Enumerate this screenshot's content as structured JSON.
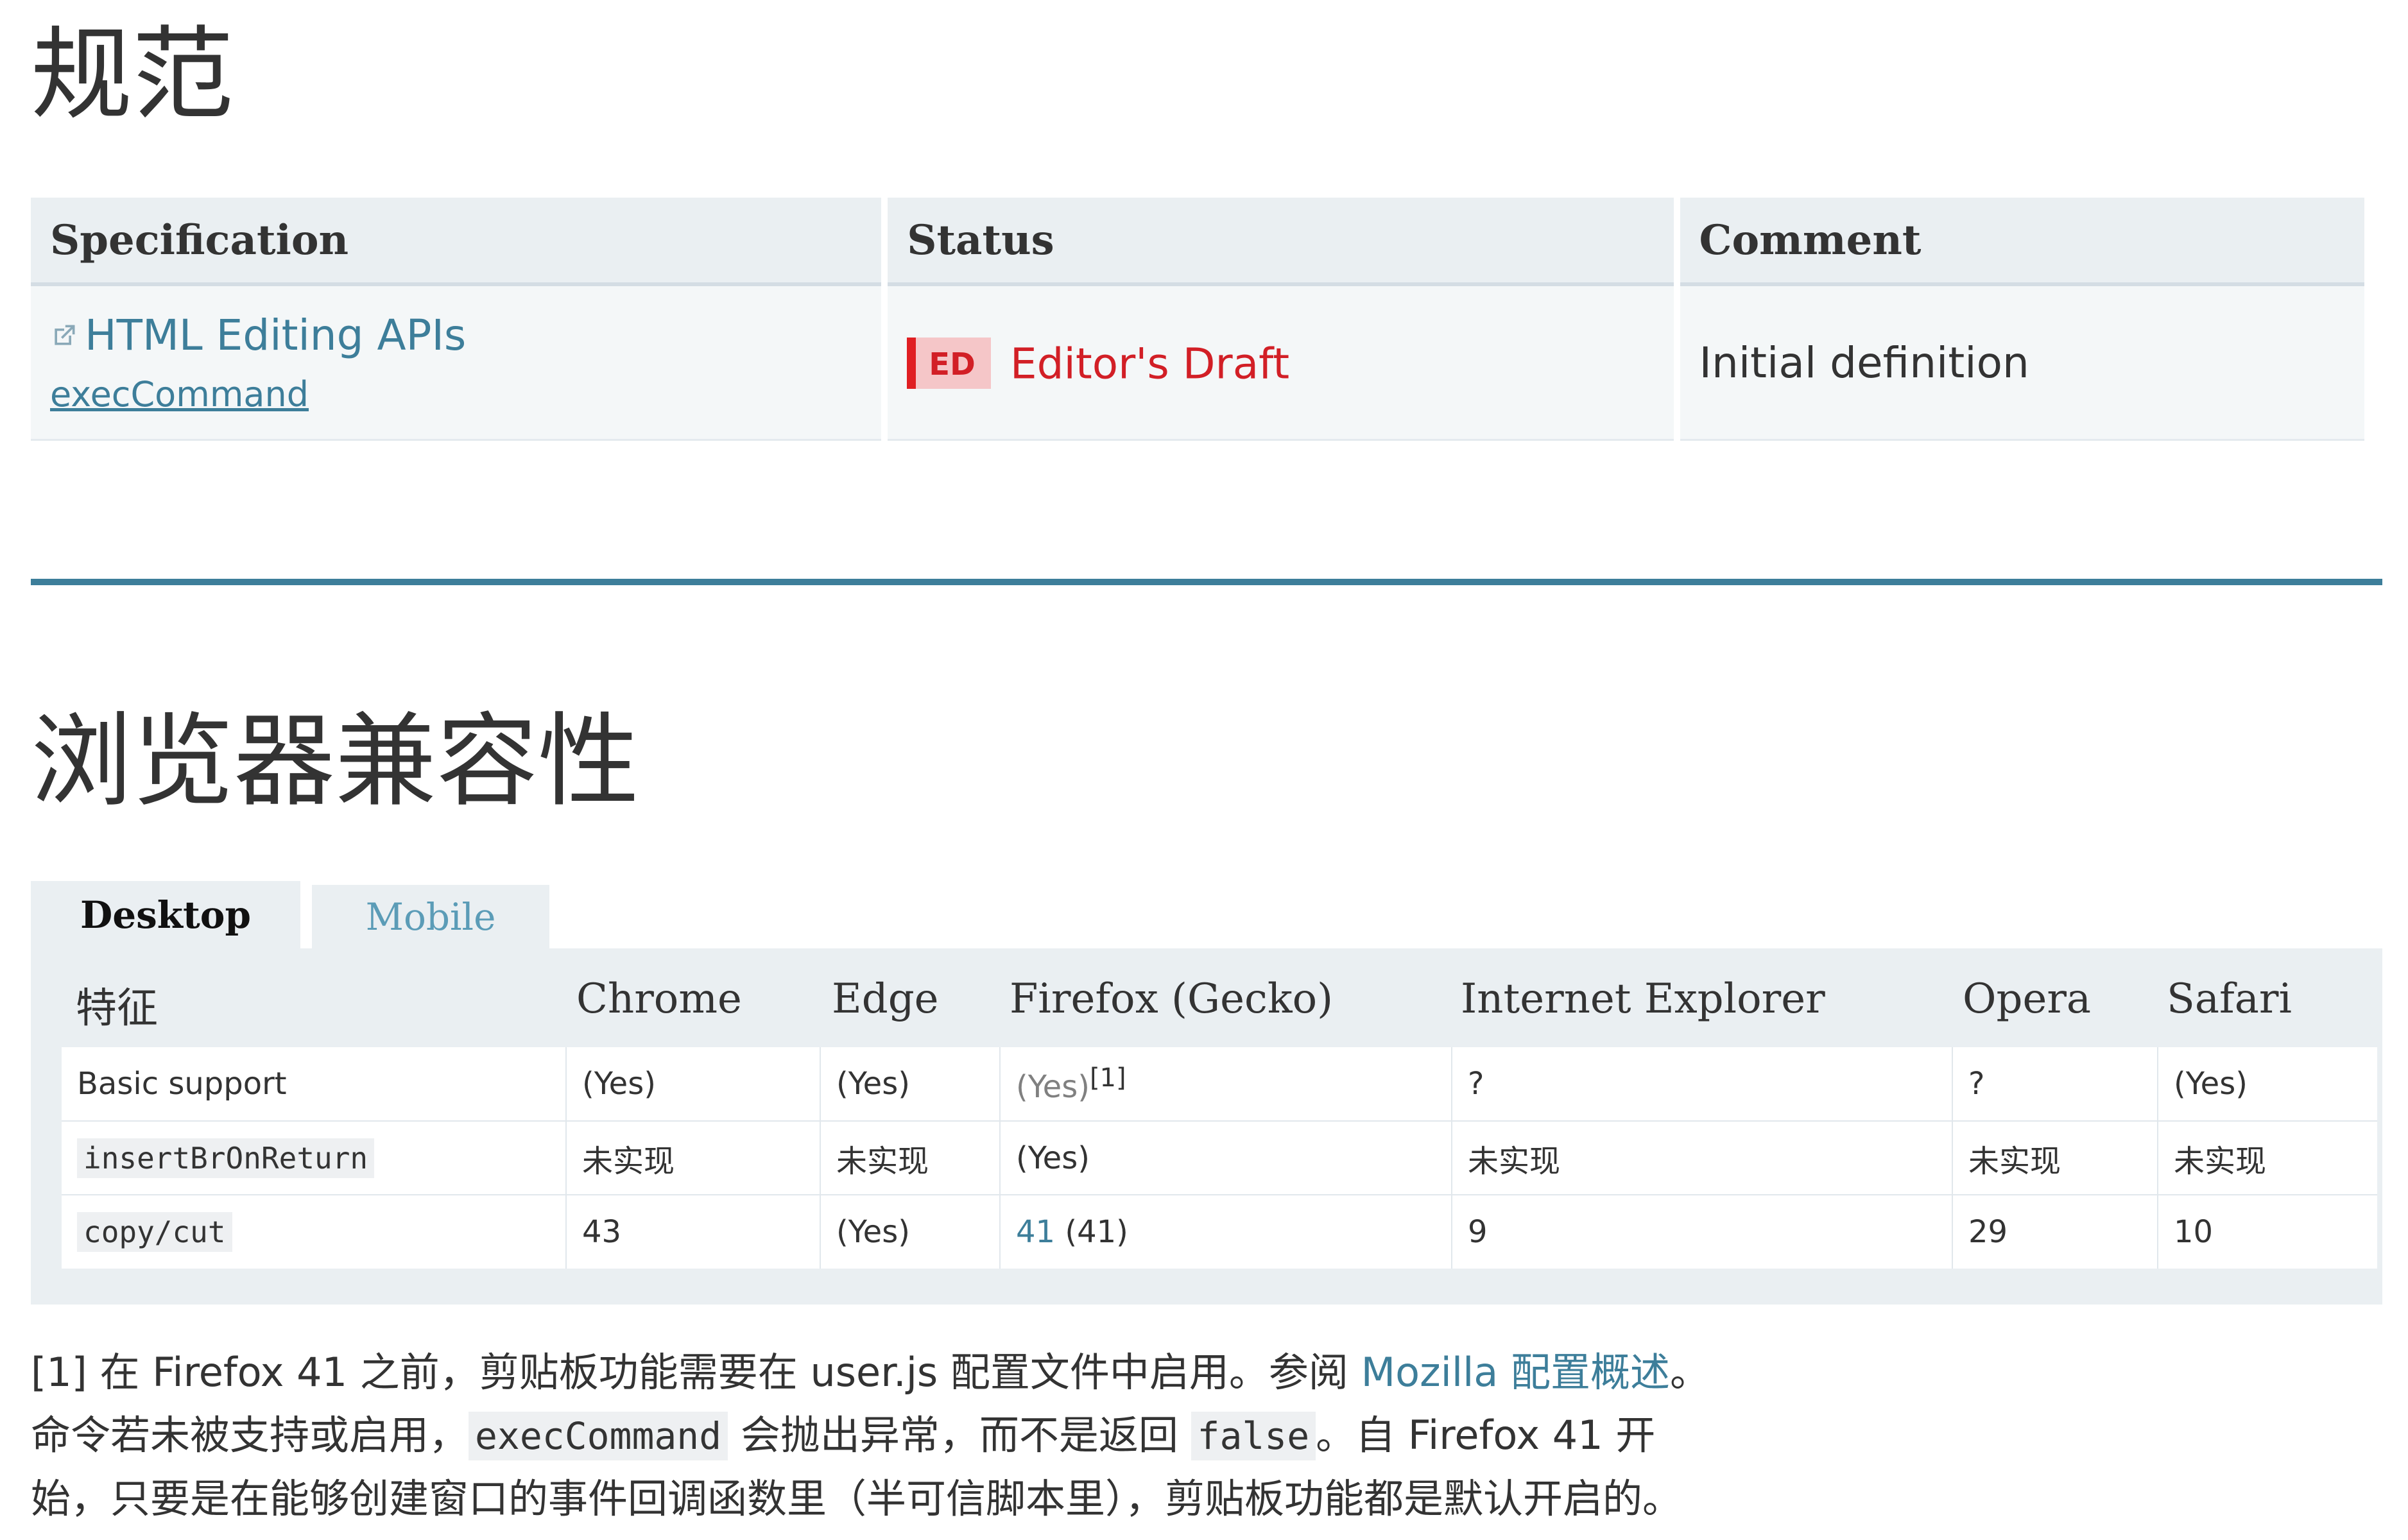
{
  "sections": {
    "spec_title": "规范",
    "compat_title": "浏览器兼容性"
  },
  "spec_table": {
    "headers": [
      "Specification",
      "Status",
      "Comment"
    ],
    "row": {
      "spec_name": "HTML Editing APIs",
      "spec_sub": "execCommand",
      "status_badge": "ED",
      "status_text": "Editor's Draft",
      "comment": "Initial definition"
    }
  },
  "compat": {
    "tabs": [
      "Desktop",
      "Mobile"
    ],
    "headers": [
      "特征",
      "Chrome",
      "Edge",
      "Firefox (Gecko)",
      "Internet Explorer",
      "Opera",
      "Safari"
    ],
    "rows": [
      {
        "feature": "Basic support",
        "chrome": "(Yes)",
        "edge": "(Yes)",
        "firefox": "(Yes)",
        "firefox_note": "[1]",
        "ie": "?",
        "opera": "?",
        "safari": "(Yes)"
      },
      {
        "feature": "insertBrOnReturn",
        "chrome": "未实现",
        "edge": "未实现",
        "firefox": "(Yes)",
        "ie": "未实现",
        "opera": "未实现",
        "safari": "未实现"
      },
      {
        "feature_a": "copy",
        "feature_sep": "/",
        "feature_b": "cut",
        "chrome": "43",
        "edge": "(Yes)",
        "firefox_link": "41",
        "firefox_rest": " (41)",
        "ie": "9",
        "opera": "29",
        "safari": "10"
      }
    ]
  },
  "notes": {
    "line1_a": "[1] 在 Firefox 41 之前，剪贴板功能需要在 user.js 配置文件中启用。参阅 ",
    "line1_link": "Mozilla 配置概述",
    "line1_b": "。",
    "line2_a": "命令若未被支持或启用，",
    "line2_code1": "execCommand",
    "line2_b": " 会抛出异常，而不是返回 ",
    "line2_code2": "false",
    "line2_c": "。自 Firefox 41 开",
    "line3": "始，只要是在能够创建窗口的事件回调函数里（半可信脚本里），剪贴板功能都是默认开启的。"
  },
  "colors": {
    "link": "#3d7e9a",
    "unsupported": "#d21f26",
    "unknown": "#e48a1f",
    "header_bg": "#eaeff2"
  },
  "icons": [
    "external-link-icon"
  ]
}
